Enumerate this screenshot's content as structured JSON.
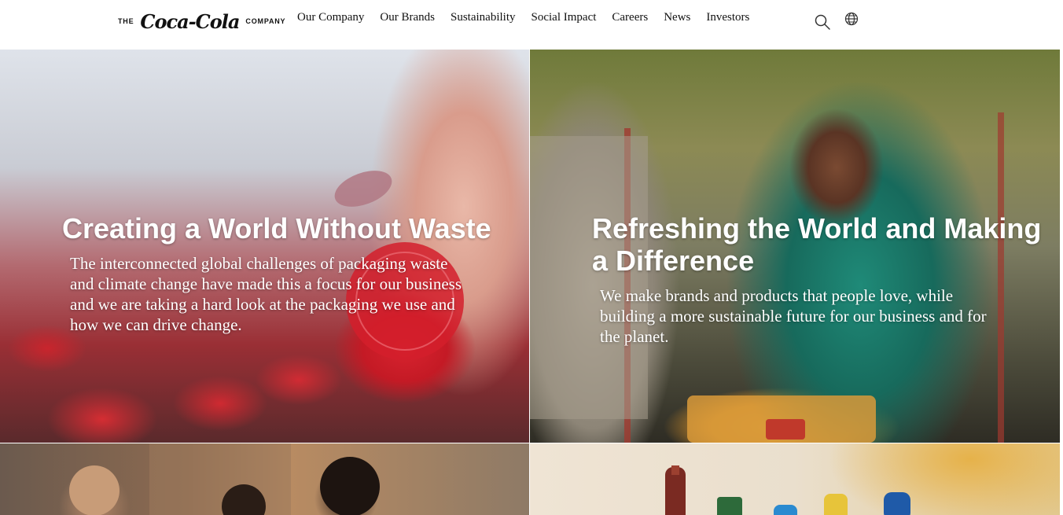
{
  "header": {
    "logo": {
      "prefix": "THE",
      "brand": "Coca-Cola",
      "suffix": "COMPANY"
    },
    "nav": [
      {
        "label": "Our Company"
      },
      {
        "label": "Our Brands"
      },
      {
        "label": "Sustainability"
      },
      {
        "label": "Social Impact"
      },
      {
        "label": "Careers"
      },
      {
        "label": "News"
      },
      {
        "label": "Investors"
      }
    ],
    "icons": {
      "search": "search-icon",
      "language": "globe-icon"
    }
  },
  "tiles": {
    "waste": {
      "heading": "Creating a World Without Waste",
      "body": "The interconnected global challenges of packaging waste and climate change have made this a focus for our business and we are taking a hard look at the packaging we use and how we can drive change."
    },
    "water": {
      "heading": "Refreshing the World and Making a Difference",
      "body": "We make brands and products that people love, while building a more sustainable future for our business and for the planet."
    }
  },
  "colors": {
    "text_dark": "#111111",
    "overlay_text": "#ffffff",
    "background": "#ffffff"
  }
}
